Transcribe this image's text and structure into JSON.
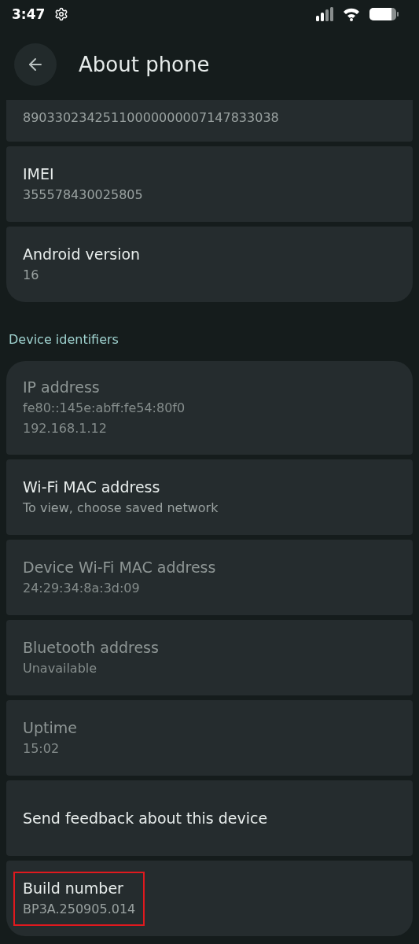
{
  "status_bar": {
    "time": "3:47"
  },
  "app_bar": {
    "title": "About phone"
  },
  "groups": [
    {
      "items": [
        {
          "kind": "clipped",
          "value": "89033023425110000000007147833038"
        },
        {
          "kind": "detail",
          "title": "IMEI",
          "value": "355578430025805",
          "disabled": false,
          "highlighted": false
        },
        {
          "kind": "detail",
          "title": "Android version",
          "value": "16",
          "disabled": false,
          "highlighted": false
        }
      ]
    },
    {
      "header": "Device identifiers",
      "items": [
        {
          "kind": "detail",
          "title": "IP address",
          "value": "fe80::145e:abff:fe54:80f0\n192.168.1.12",
          "disabled": true,
          "highlighted": false
        },
        {
          "kind": "detail",
          "title": "Wi-Fi MAC address",
          "value": "To view, choose saved network",
          "disabled": false,
          "highlighted": false
        },
        {
          "kind": "detail",
          "title": "Device Wi-Fi MAC address",
          "value": "24:29:34:8a:3d:09",
          "disabled": true,
          "highlighted": false
        },
        {
          "kind": "detail",
          "title": "Bluetooth address",
          "value": "Unavailable",
          "disabled": true,
          "highlighted": false
        },
        {
          "kind": "detail",
          "title": "Uptime",
          "value": "15:02",
          "disabled": true,
          "highlighted": false
        },
        {
          "kind": "action",
          "title": "Send feedback about this device",
          "disabled": false,
          "highlighted": false
        },
        {
          "kind": "detail",
          "title": "Build number",
          "value": "BP3A.250905.014",
          "disabled": false,
          "highlighted": true
        }
      ]
    }
  ]
}
